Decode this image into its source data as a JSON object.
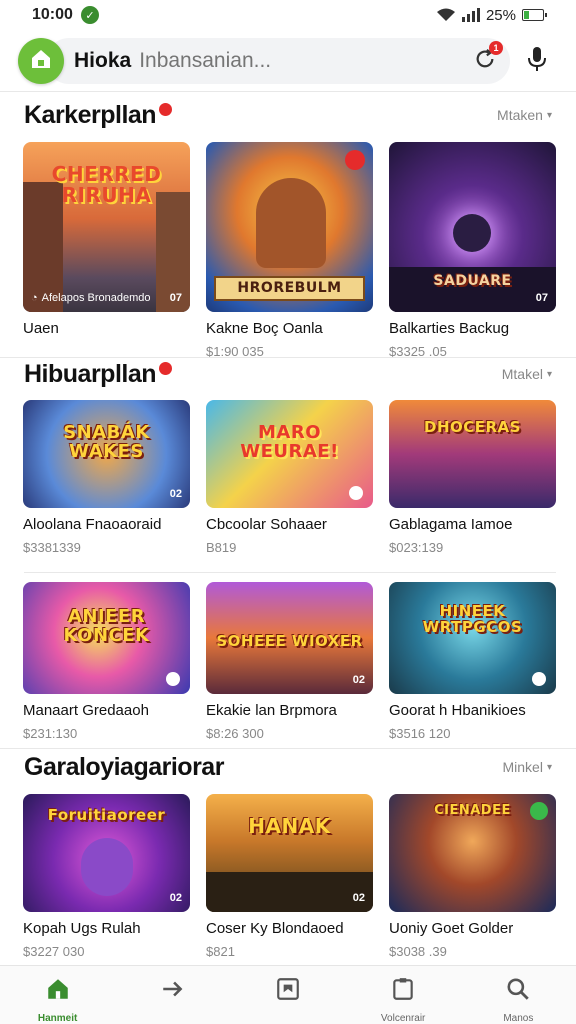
{
  "status_bar": {
    "time": "10:00",
    "battery": "25%",
    "battery_level": 0.25,
    "colors": {
      "app_icon": "#3a8d2f",
      "battery": "#3cb043"
    }
  },
  "search": {
    "brand": "Hioka",
    "placeholder": "Inbansanian...",
    "notification_count": "1",
    "icons": [
      "home-logo-icon",
      "refresh-icon",
      "mic-icon"
    ]
  },
  "sections": [
    {
      "title": "Karkerpllan",
      "more": "Mtaken",
      "cards": [
        {
          "image_text": "CHERRED RIRUHA",
          "overlay": "Afelapos Bronademdo",
          "badge": "07",
          "name": "Uaen",
          "price": ""
        },
        {
          "image_text": "HROREBULM",
          "badge": "",
          "name": "Kakne Boç Oanla",
          "price": "$1:90 035"
        },
        {
          "image_text": "SADUARE",
          "badge": "07",
          "name": "Balkarties Backug",
          "price": "$3325 .05"
        }
      ]
    },
    {
      "title": "Hibuarpllan",
      "more": "Mtakel",
      "cards": [
        {
          "image_text": "SNABÁK WAKES",
          "badge": "02",
          "name": "Aloolana Fnaoaoraid",
          "price": "$3381339"
        },
        {
          "image_text": "MARO WEURAE!",
          "badge": "",
          "name": "Cbcoolar Sohaaer",
          "price": "B819"
        },
        {
          "image_text": "DHOCERAS",
          "badge": "",
          "name": "Gablagama Iamoe",
          "price": "$023:139"
        }
      ]
    },
    {
      "title": "",
      "more": "",
      "cards": [
        {
          "image_text": "ANIEER KONCEK",
          "badge": "",
          "name": "Manaart Gredaaoh",
          "price": "$231:130"
        },
        {
          "image_text": "SOHEEE WIOXER",
          "badge": "02",
          "name": "Ekakie lan Brpmora",
          "price": "$8:26 300"
        },
        {
          "image_text": "HINEEK WRTPGCOS",
          "badge": "",
          "name": "Goorat h Hbanikioes",
          "price": "$3516 120"
        }
      ]
    },
    {
      "title": "Garaloyiagariorar",
      "more": "Minkel",
      "cards": [
        {
          "image_text": "Foruitiaoreer",
          "badge": "02",
          "name": "Kopah Ugs Rulah",
          "price": "$3227 030"
        },
        {
          "image_text": "HANAK",
          "badge": "02",
          "name": "Coser Ky Blondaoed",
          "price": "$821"
        },
        {
          "image_text": "CIENADEE",
          "badge": "",
          "name": "Uoniy Goet Golder",
          "price": "$3038 .39"
        }
      ]
    }
  ],
  "bottom_nav": [
    {
      "label": "Hanmeit",
      "icon": "home-icon",
      "active": true
    },
    {
      "label": "",
      "icon": "arrow-right-icon",
      "active": false
    },
    {
      "label": "",
      "icon": "bookmark-box-icon",
      "active": false
    },
    {
      "label": "Volcenrair",
      "icon": "clipboard-icon",
      "active": false
    },
    {
      "label": "Manos",
      "icon": "search-icon",
      "active": false
    }
  ],
  "colors": {
    "accent": "#3a8d2f",
    "logo": "#6dbf3a",
    "notification": "#e52b2b",
    "text_muted": "#888888"
  }
}
